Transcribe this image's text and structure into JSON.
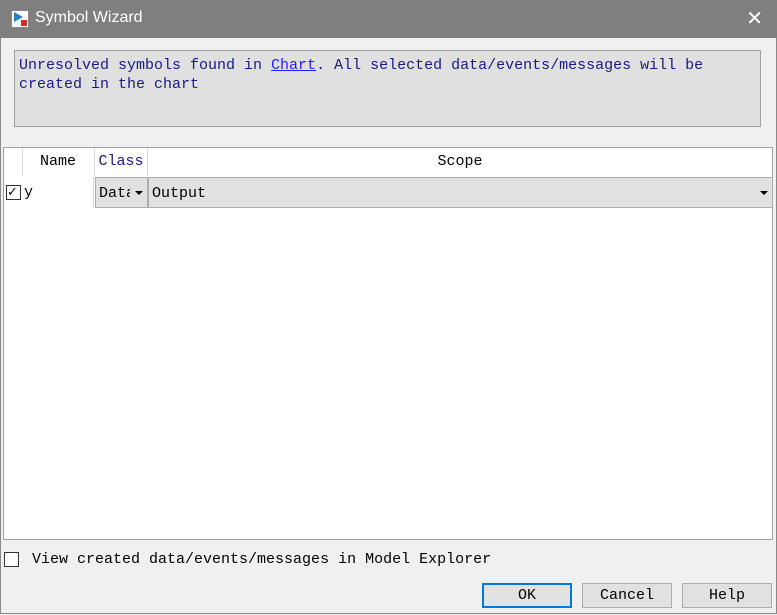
{
  "window": {
    "title": "Symbol Wizard",
    "app_icon": "stateflow-icon"
  },
  "message": {
    "prefix": "Unresolved symbols found in ",
    "link": "Chart",
    "suffix": ". All selected data/events/messages will be created in the chart"
  },
  "table": {
    "columns": [
      "",
      "Name",
      "Class",
      "Scope"
    ],
    "rows": [
      {
        "checked": true,
        "name": "y",
        "class": "Data",
        "scope": "Output"
      }
    ]
  },
  "footer": {
    "checkbox_label": "View created data/events/messages in Model Explorer",
    "checked": false
  },
  "buttons": {
    "ok": "OK",
    "cancel": "Cancel",
    "help": "Help"
  }
}
